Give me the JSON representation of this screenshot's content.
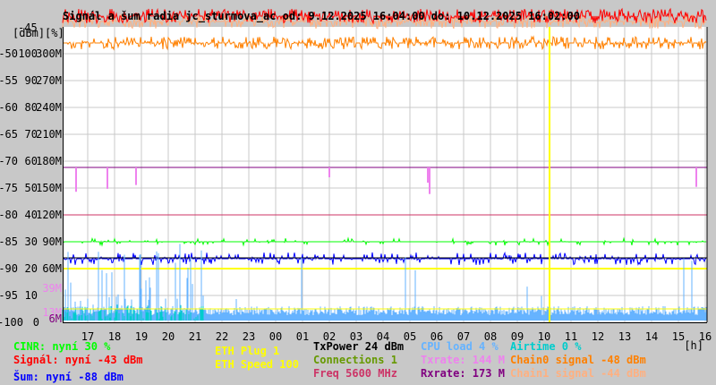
{
  "title": "Signál a šum radia jc_sturmova_ac od: 9.12.2025 16:04:00 do: 10.12.2025 16:02:00",
  "colors": {
    "cinr": "#00ff00",
    "signal": "#ff0000",
    "noise": "#0000ff",
    "eth_plug": "#ffff00",
    "eth_speed": "#ffff00",
    "txpower": "#000000",
    "connections": "#669900",
    "freq": "#cc3366",
    "cpu": "#66b3ff",
    "txrate": "#ee82ee",
    "rxrate": "#800080",
    "airtime": "#00cccc",
    "chain0": "#ff8000",
    "chain1": "#ffb080"
  },
  "chart_data": {
    "type": "line",
    "title": "Signál a šum radia jc_sturmova_ac od: 9.12.2025 16:04:00 do: 10.12.2025 16:02:00",
    "xlabel": "[h]",
    "ylabel_units": [
      "[dBm]",
      "[%]"
    ],
    "x_ticks": [
      "17",
      "18",
      "19",
      "20",
      "21",
      "22",
      "23",
      "00",
      "01",
      "02",
      "03",
      "04",
      "05",
      "06",
      "07",
      "08",
      "09",
      "10",
      "11",
      "12",
      "13",
      "14",
      "15",
      "16"
    ],
    "y_top_label": "-45",
    "y_ticks_dbm": [
      "-50",
      "-55",
      "-60",
      "-65",
      "-70",
      "-75",
      "-80",
      "-85",
      "-90",
      "-95",
      "-100"
    ],
    "y_ticks_pct": [
      "100",
      "90",
      "80",
      "70",
      "60",
      "50",
      "40",
      "30",
      "20",
      "10",
      "0"
    ],
    "y_ticks_rate": [
      "300M",
      "270M",
      "240M",
      "210M",
      "180M",
      "150M",
      "120M",
      "90M",
      "60M",
      "",
      ""
    ],
    "extra_rate_labels": [
      {
        "text": "39M",
        "color": "#ee82ee"
      },
      {
        "text": "13M",
        "color": "#ee82ee"
      },
      {
        "text": "6M",
        "color": "#800080"
      }
    ],
    "ylim_dbm": [
      -100,
      -45
    ],
    "grid": true,
    "marker_hour": "10",
    "series": [
      {
        "name": "Signál",
        "unit": "dBm",
        "current": -43
      },
      {
        "name": "Chain0 signal",
        "unit": "dBm",
        "current": -48
      },
      {
        "name": "Chain1 signal",
        "unit": "dBm",
        "current": -44
      },
      {
        "name": "Šum",
        "unit": "dBm",
        "current": -88
      },
      {
        "name": "CINR",
        "unit": "%",
        "current": 30
      },
      {
        "name": "Rxrate",
        "unit": "M",
        "current": 173
      },
      {
        "name": "Txrate",
        "unit": "M",
        "current": 144
      },
      {
        "name": "Freq",
        "unit": "MHz",
        "current": 5600
      },
      {
        "name": "CPU load",
        "unit": "%",
        "current": 4
      },
      {
        "name": "Airtime",
        "unit": "%",
        "current": 0
      }
    ]
  },
  "legend": {
    "cinr": "CINR: nyní 30 %",
    "signal": "Signál: nyní -43 dBm",
    "noise": "Šum: nyní -88 dBm",
    "eth_plug": "ETH Plug 1",
    "eth_speed": "ETH Speed 100",
    "txpower": "TxPower 24 dBm",
    "connections": "Connections 1",
    "freq": "Freq 5600 MHz",
    "cpu": "CPU load 4 %",
    "txrate": "Txrate: 144 M",
    "rxrate": "Rxrate: 173 M",
    "airtime": "Airtime 0 %",
    "chain0": "Chain0 signal -48 dBm",
    "chain1": "Chain1 signal -44 dBm"
  }
}
